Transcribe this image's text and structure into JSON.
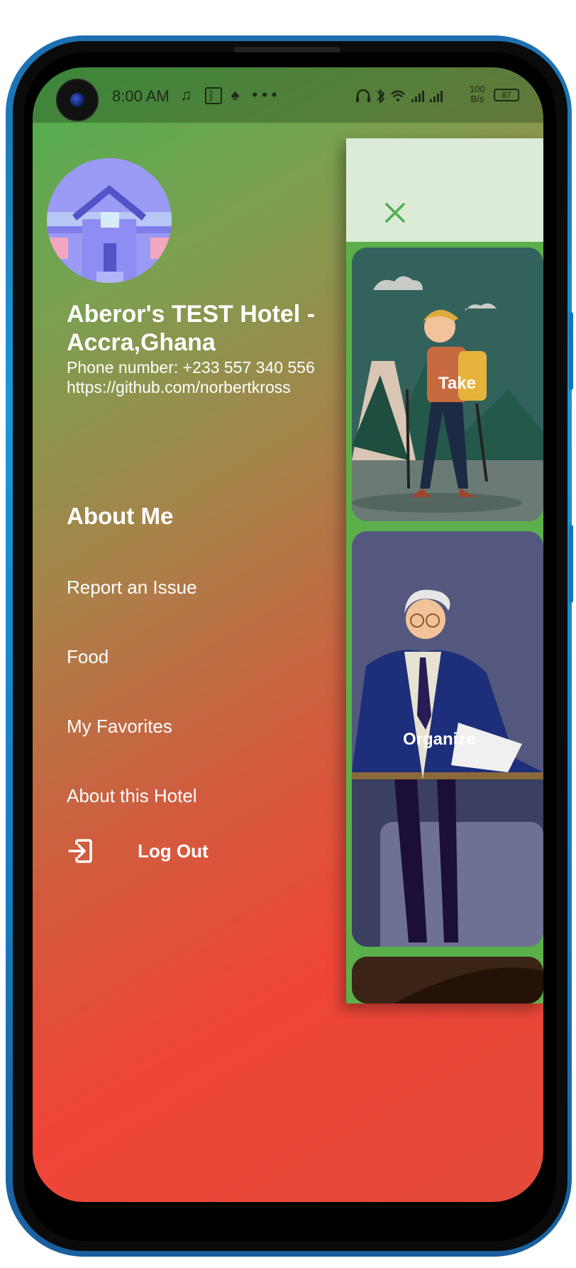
{
  "status_bar": {
    "time": "8:00 AM",
    "left_icons": [
      "music-note-icon",
      "bluetooth-box-icon",
      "leaf-icon",
      "more-dots-icon"
    ],
    "right_icons": [
      "headphones-icon",
      "bluetooth-icon",
      "wifi-icon",
      "signal-icon",
      "signal-icon"
    ],
    "speed_value": "100",
    "speed_unit": "B/s",
    "battery": "87"
  },
  "drawer": {
    "hotel_name": "Aberor's TEST Hotel - Accra,Ghana",
    "phone": "Phone number: +233 557 340 556",
    "website": "https://github.com/norbertkross",
    "section_title": "About Me",
    "menu": [
      {
        "label": "Report an Issue"
      },
      {
        "label": "Food"
      },
      {
        "label": "My Favorites"
      },
      {
        "label": "About this Hotel"
      }
    ],
    "logout_label": "Log Out"
  },
  "main": {
    "cards": [
      {
        "label": "Take"
      },
      {
        "label": "Organize"
      }
    ]
  },
  "colors": {
    "gradient_start": "#4caf50",
    "gradient_end": "#ef4538",
    "accent_green": "#4caf50"
  }
}
